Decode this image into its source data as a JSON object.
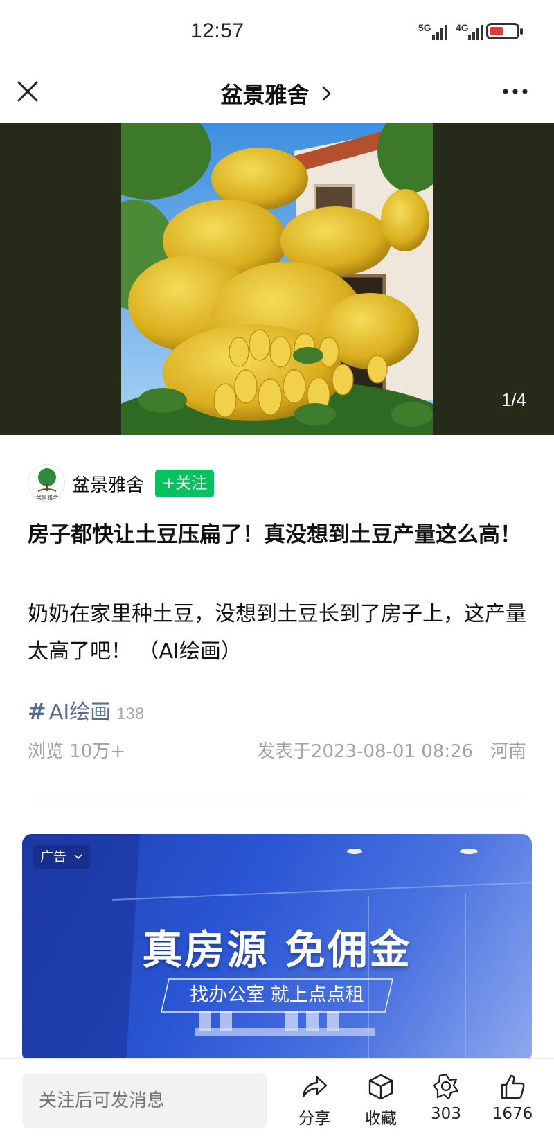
{
  "status_bar": {
    "time": "12:57",
    "signal1_label": "5G",
    "signal2_label": "4G",
    "battery_color": "#e53935"
  },
  "nav": {
    "title": "盆景雅舍",
    "close_icon": "close-icon",
    "more_icon": "more-icon"
  },
  "image": {
    "page_indicator": "1/4",
    "background_color": "#252a19"
  },
  "author": {
    "name": "盆景雅舍",
    "follow_label": "+关注",
    "follow_color": "#07c160",
    "avatar_text": "盆景雅舍"
  },
  "post": {
    "title": "房子都快让土豆压扁了！真没想到土豆产量这么高！",
    "content": "奶奶在家里种土豆，没想到土豆长到了房子上，这产量太高了吧！ （AI绘画）",
    "tag": {
      "hash": "#",
      "name": "AI绘画",
      "count": "138",
      "color": "#576b95"
    },
    "views": "浏览 10万+",
    "published": "发表于2023-08-01 08:26   河南"
  },
  "ad": {
    "badge": "广告",
    "headline": "真房源 免佣金",
    "subline": "找办公室 就上点点租"
  },
  "bottom_bar": {
    "input_placeholder": "关注后可发消息",
    "share_label": "分享",
    "collect_label": "收藏",
    "wow_count": "303",
    "like_count": "1676"
  }
}
